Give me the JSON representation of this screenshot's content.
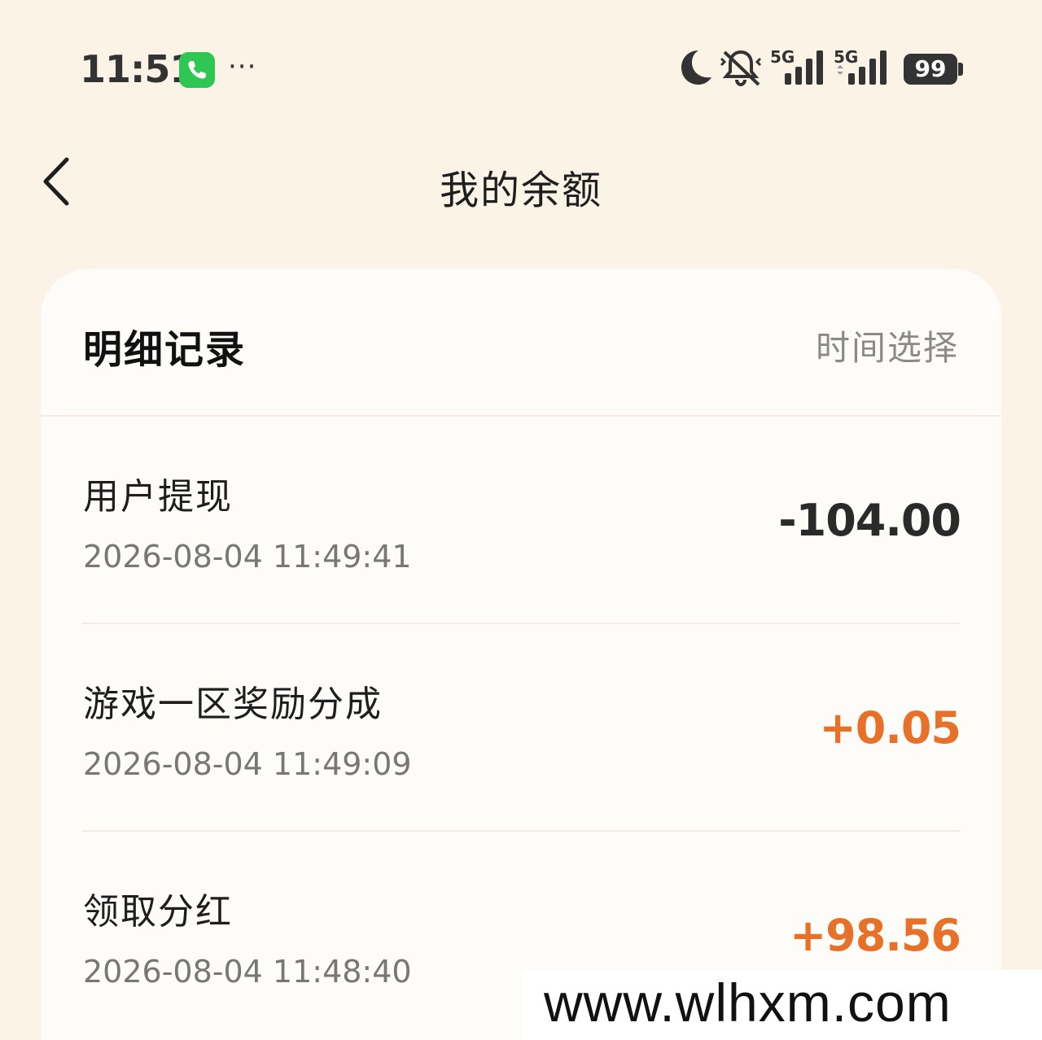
{
  "status_bar": {
    "time": "11:51",
    "more": "···",
    "network1": "5G",
    "network2": "5G",
    "battery": "99",
    "icons": [
      "phone-icon",
      "moon-icon",
      "mute-bell-icon",
      "signal-icon",
      "signal-icon",
      "battery-icon"
    ],
    "colors": {
      "phone_app": "#2fc653"
    }
  },
  "nav": {
    "back_icon": "chevron-left-icon",
    "title": "我的余额"
  },
  "card": {
    "title": "明细记录",
    "filter_label": "时间选择",
    "records": [
      {
        "title": "用户提现",
        "time": "2026-08-04 11:49:41",
        "amount": "-104.00",
        "type": "negative"
      },
      {
        "title": "游戏一区奖励分成",
        "time": "2026-08-04 11:49:09",
        "amount": "+0.05",
        "type": "positive"
      },
      {
        "title": "领取分红",
        "time": "2026-08-04 11:48:40",
        "amount": "+98.56",
        "type": "positive"
      }
    ],
    "colors": {
      "positive": "#e8712a",
      "negative": "#2a2a2a"
    }
  },
  "watermark": "www.wlhxm.com"
}
